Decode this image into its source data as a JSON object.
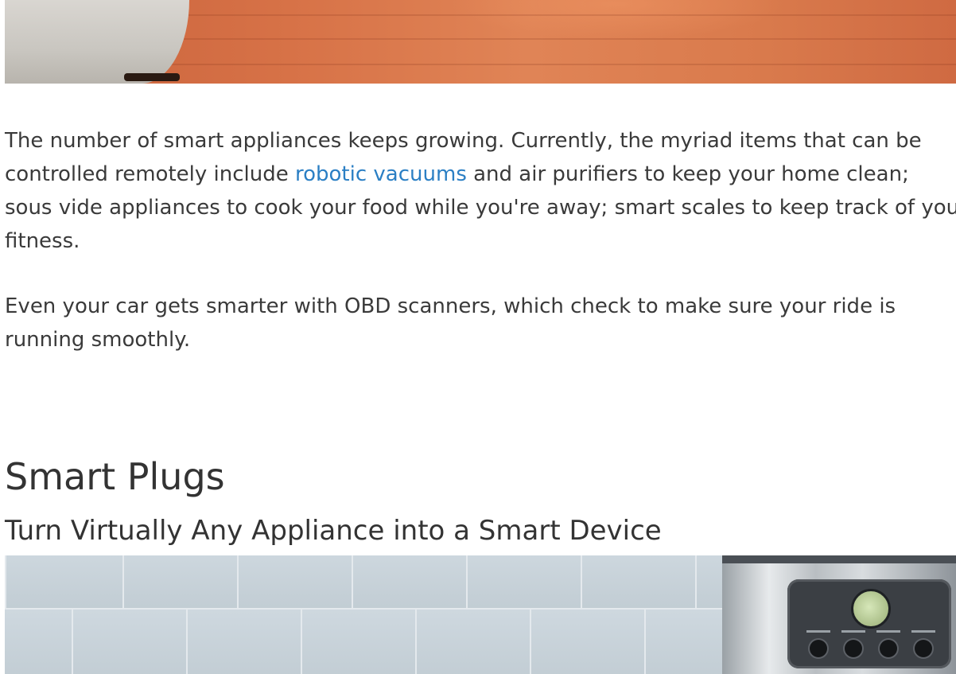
{
  "article": {
    "paragraph1": {
      "line1": "The number of smart appliances keeps growing. Currently, the myriad items that can be",
      "line2_before_link": "controlled remotely include ",
      "link_text": "robotic vacuums",
      "line2_after_link": " and air purifiers to keep your home clean;",
      "line3": "sous vide appliances to cook your food while you're away; smart scales to keep track of your",
      "line4": "fitness."
    },
    "paragraph2": {
      "line1": "Even your car gets smarter with OBD scanners, which check to make sure your ride is",
      "line2": "running smoothly."
    }
  },
  "section": {
    "title": "Smart Plugs",
    "subtitle": "Turn Virtually Any Appliance into a Smart Device"
  },
  "colors": {
    "link": "#2b7fc4",
    "text": "#3a3a3a",
    "heading": "#333333"
  }
}
